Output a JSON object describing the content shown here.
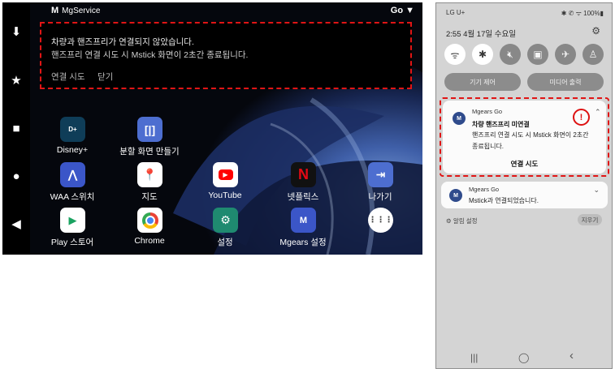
{
  "car": {
    "status": {
      "app_logo": "M",
      "app_name": "MgService",
      "right": "Go"
    },
    "nav_icons": [
      "download-icon",
      "star-icon",
      "square-icon",
      "circle-icon",
      "back-triangle-icon"
    ],
    "banner": {
      "line1": "차량과 핸즈프리가 연결되지 않았습니다.",
      "line2": "핸즈프리 연결 시도 시 Mstick 화면이 2초간 종료됩니다.",
      "btn_connect": "연결 시도",
      "btn_close": "닫기"
    },
    "apps": [
      {
        "label": "Disney+",
        "icon": "disney-icon",
        "color": "#0f3d58"
      },
      {
        "label": "분할 화면 만들기",
        "icon": "split-screen-icon",
        "color": "#4d6ed0"
      },
      {
        "label": "WAA 스위치",
        "icon": "waa-icon",
        "color": "#3b56c8"
      },
      {
        "label": "지도",
        "icon": "maps-icon",
        "color": "#ffffff"
      },
      {
        "label": "YouTube",
        "icon": "youtube-icon",
        "color": "#ffffff"
      },
      {
        "label": "넷플릭스",
        "icon": "netflix-icon",
        "color": "#111111"
      },
      {
        "label": "나가기",
        "icon": "exit-icon",
        "color": "#4d6ed0"
      },
      {
        "label": "Play 스토어",
        "icon": "play-store-icon",
        "color": "#ffffff"
      },
      {
        "label": "Chrome",
        "icon": "chrome-icon",
        "color": "#ffffff"
      },
      {
        "label": "설정",
        "icon": "settings-icon",
        "color": "#1f8a70"
      },
      {
        "label": "Mgears 설정",
        "icon": "mgears-icon",
        "color": "#3b56c8"
      },
      {
        "label": "",
        "icon": "app-drawer-icon",
        "color": "#ffffff"
      }
    ]
  },
  "phone": {
    "status": {
      "carrier": "LG U+",
      "right": "✱ ✆ ᯤ 100%▮"
    },
    "datetime": "2:55  4월 17일 수요일",
    "quick_settings": [
      "wifi-icon",
      "bluetooth-icon",
      "mute-icon",
      "lock-icon",
      "airplane-icon",
      "flashlight-icon"
    ],
    "pills": {
      "device_control": "기기 제어",
      "media_output": "미디어 출력"
    },
    "notification1": {
      "app": "Mgears Go",
      "title": "차량 핸즈프리 미연결",
      "body1": "핸즈프리 연결 시도 시 Mstick 화면이 2초간",
      "body2": "종료됩니다.",
      "action": "연결 시도"
    },
    "notification2": {
      "app": "Mgears Go",
      "body": "Mstick과 연결되었습니다."
    },
    "notif_settings": "알림 설정",
    "clear": "지우기",
    "nav": [
      "|||",
      "◯",
      "‹"
    ]
  }
}
